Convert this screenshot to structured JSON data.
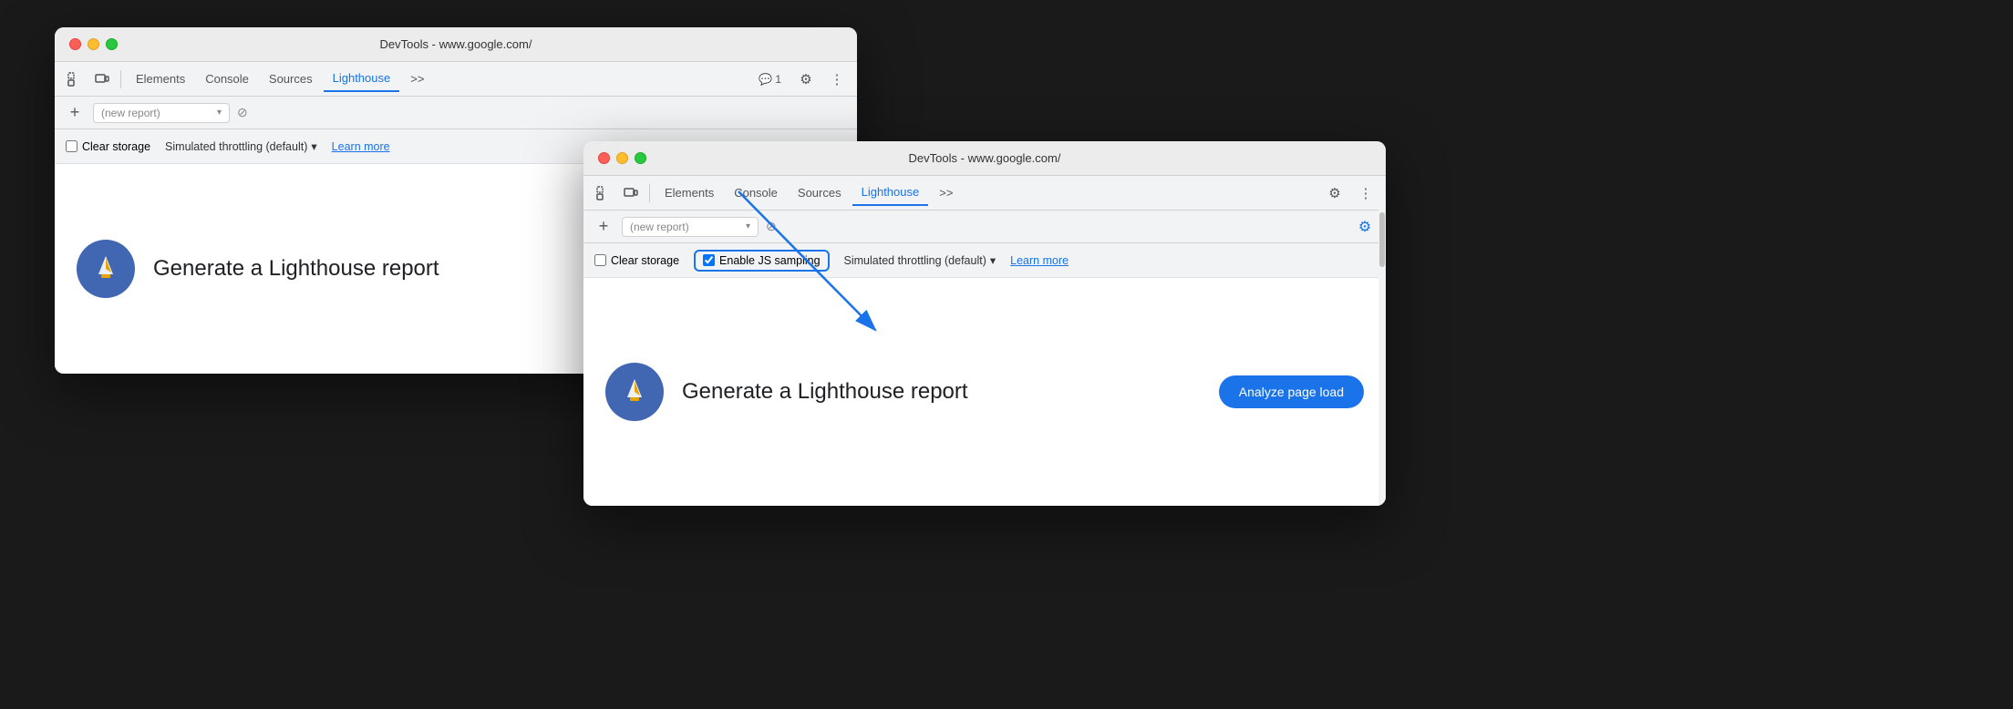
{
  "window_back": {
    "title": "DevTools - www.google.com/",
    "traffic_lights": [
      "red",
      "yellow",
      "green"
    ],
    "tabs": [
      "Elements",
      "Console",
      "Sources",
      "Lighthouse"
    ],
    "active_tab": "Lighthouse",
    "more_tabs_label": ">>",
    "badges": {
      "console": "1"
    },
    "report_placeholder": "(new report)",
    "options": {
      "clear_storage": "Clear storage",
      "throttling": "Simulated throttling (default)",
      "learn_more": "Learn more"
    },
    "main": {
      "generate_text": "Generate a Lighthouse report"
    }
  },
  "window_front": {
    "title": "DevTools - www.google.com/",
    "tabs": [
      "Elements",
      "Console",
      "Sources",
      "Lighthouse"
    ],
    "active_tab": "Lighthouse",
    "more_tabs_label": ">>",
    "report_placeholder": "(new report)",
    "options": {
      "clear_storage": "Clear storage",
      "enable_js_sampling": "Enable JS sampling",
      "throttling": "Simulated throttling (default)",
      "learn_more": "Learn more"
    },
    "main": {
      "generate_text": "Generate a Lighthouse report",
      "analyze_btn": "Analyze page load"
    }
  },
  "icons": {
    "add": "+",
    "delete": "⊘",
    "dropdown": "▾",
    "more": "⋮",
    "settings": "⚙",
    "console_icon": "💬",
    "chevron_down": "▾",
    "cursor": "⬛",
    "device": "⬜"
  }
}
